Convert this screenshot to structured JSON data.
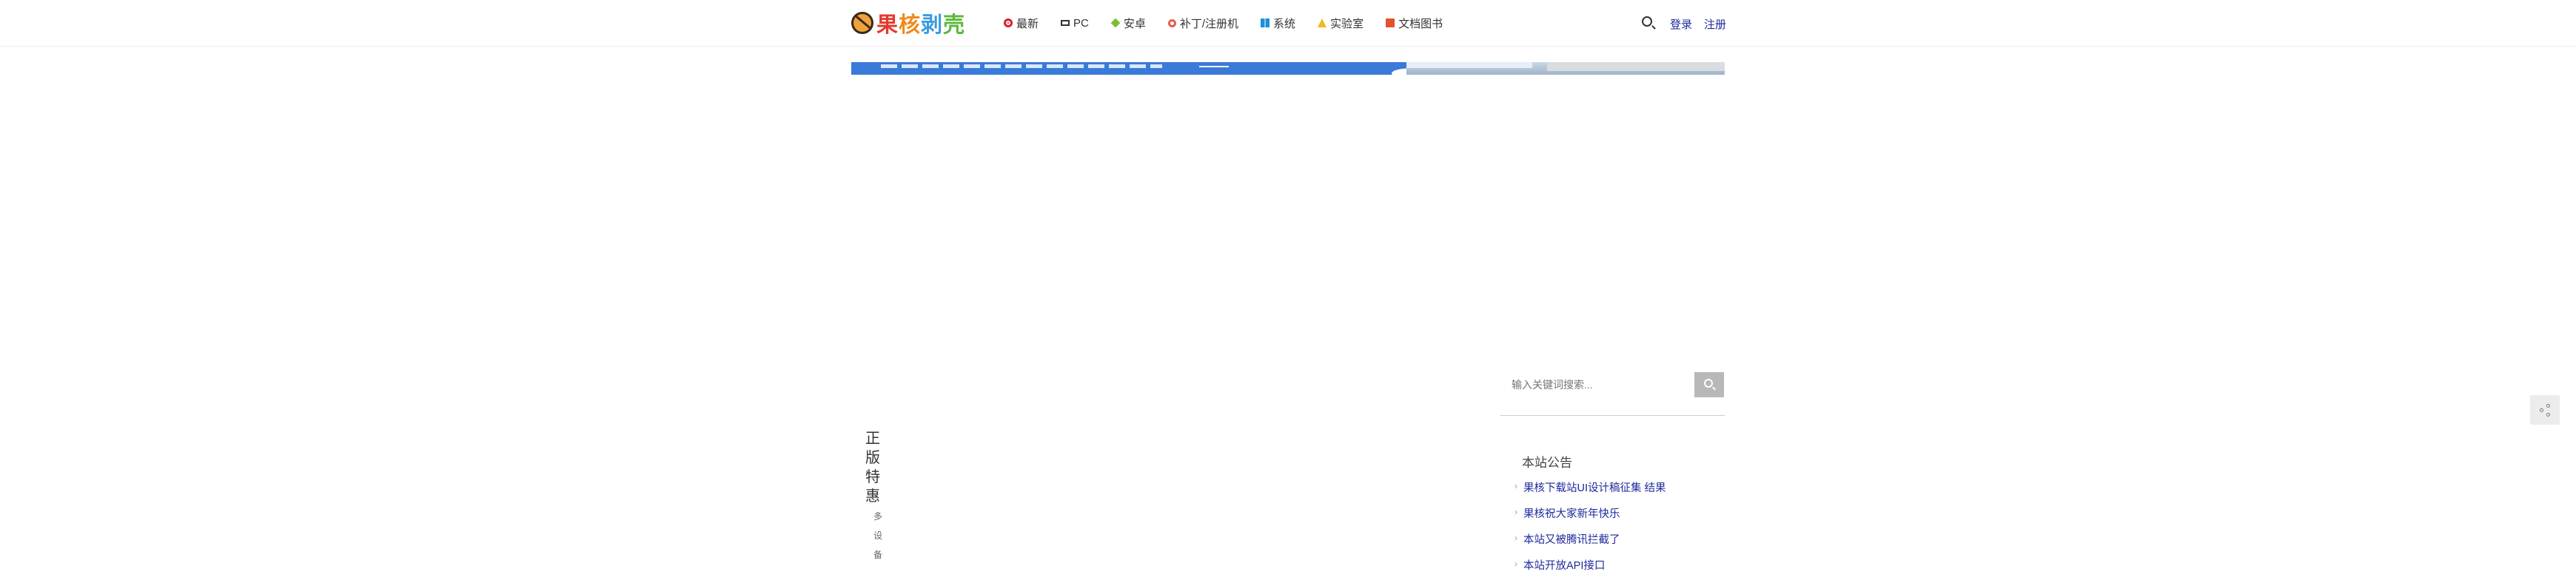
{
  "site": {
    "logo_text": "果核剥壳"
  },
  "nav": [
    {
      "label": "最新",
      "icon": "record-icon"
    },
    {
      "label": "PC",
      "icon": "monitor-icon"
    },
    {
      "label": "安卓",
      "icon": "diamond-icon"
    },
    {
      "label": "补丁/注册机",
      "icon": "gear-icon"
    },
    {
      "label": "系统",
      "icon": "windows-icon"
    },
    {
      "label": "实验室",
      "icon": "flask-icon"
    },
    {
      "label": "文档图书",
      "icon": "book-icon"
    }
  ],
  "header": {
    "login_label": "登录",
    "register_label": "注册"
  },
  "sidebar": {
    "search_placeholder": "输入关键词搜索...",
    "notice_title": "本站公告",
    "notices": [
      "果核下载站UI设计稿征集 结果",
      "果核祝大家新年快乐",
      "本站又被腾讯拦截了",
      "本站开放API接口"
    ]
  },
  "promo": {
    "vertical_title": "正版特惠",
    "vertical_sub": "多设备"
  },
  "colors": {
    "link": "#1d2a9c",
    "accent_blue": "#3a7ad8",
    "search_button": "#b8b8b8"
  }
}
